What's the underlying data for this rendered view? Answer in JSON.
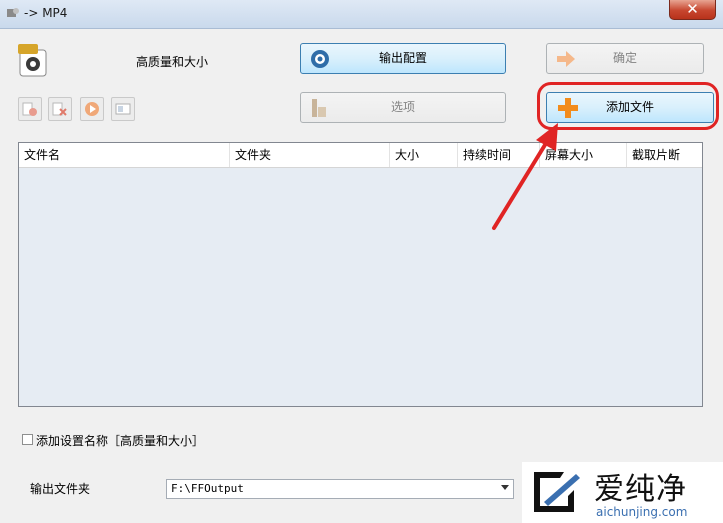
{
  "window": {
    "title": "-> MP4",
    "close_symbol": "✕"
  },
  "preset": {
    "quality_label": "高质量和大小"
  },
  "buttons": {
    "output_config": "输出配置",
    "ok": "确定",
    "options": "选项",
    "add_file": "添加文件"
  },
  "table": {
    "columns": [
      "文件名",
      "文件夹",
      "大小",
      "持续时间",
      "屏幕大小",
      "截取片断"
    ]
  },
  "add_setting_name": {
    "label": "添加设置名称［高质量和大小］",
    "checked": false
  },
  "output_folder": {
    "label": "输出文件夹",
    "value": "F:\\FFOutput"
  },
  "watermark": {
    "title": "爱纯净",
    "url": "aichunjing.com"
  },
  "colors": {
    "annotation_red": "#e02424",
    "add_icon_orange": "#f28c1c",
    "accent_blue": "#3c7fb1"
  }
}
